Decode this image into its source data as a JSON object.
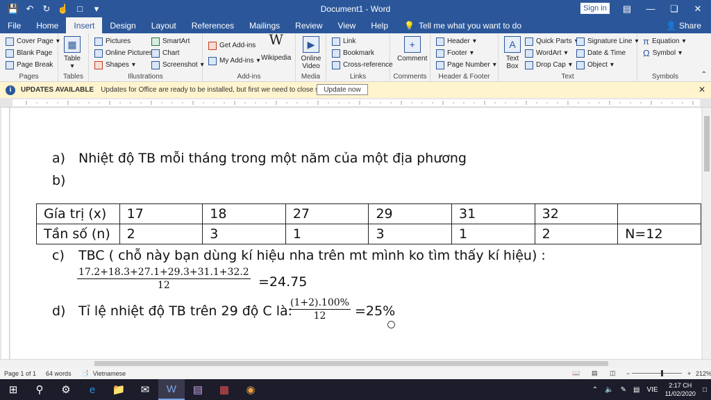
{
  "window": {
    "title": "Document1 - Word",
    "sign_in": "Sign in"
  },
  "tabs": [
    "File",
    "Home",
    "Insert",
    "Design",
    "Layout",
    "References",
    "Mailings",
    "Review",
    "View",
    "Help"
  ],
  "tell_me": "Tell me what you want to do",
  "share": "Share",
  "ribbon": {
    "pages": {
      "label": "Pages",
      "cover": "Cover Page",
      "blank": "Blank Page",
      "break": "Page Break"
    },
    "tables": {
      "label": "Tables",
      "table": "Table"
    },
    "illustrations": {
      "label": "Illustrations",
      "pictures": "Pictures",
      "online_pictures": "Online Pictures",
      "shapes": "Shapes",
      "smartart": "SmartArt",
      "chart": "Chart",
      "screenshot": "Screenshot"
    },
    "addins": {
      "label": "Add-ins",
      "get": "Get Add-ins",
      "my": "My Add-ins",
      "wikipedia": "Wikipedia"
    },
    "media": {
      "label": "Media",
      "online_video": "Online Video"
    },
    "links": {
      "label": "Links",
      "link": "Link",
      "bookmark": "Bookmark",
      "cross": "Cross-reference"
    },
    "comments": {
      "label": "Comments",
      "comment": "Comment"
    },
    "header_footer": {
      "label": "Header & Footer",
      "header": "Header",
      "footer": "Footer",
      "page_number": "Page Number"
    },
    "text": {
      "label": "Text",
      "text_box": "Text Box",
      "quick_parts": "Quick Parts",
      "wordart": "WordArt",
      "drop_cap": "Drop Cap",
      "signature": "Signature Line",
      "datetime": "Date & Time",
      "object": "Object"
    },
    "symbols": {
      "label": "Symbols",
      "equation": "Equation",
      "symbol": "Symbol"
    }
  },
  "infobar": {
    "title": "UPDATES AVAILABLE",
    "message": "Updates for Office are ready to be installed, but first we need to close some apps.",
    "button": "Update now"
  },
  "document": {
    "line_a_marker": "a)",
    "line_a_text": "Nhiệt độ TB mỗi tháng trong một năm của một địa phương",
    "line_b_marker": "b)",
    "table": {
      "row1": [
        "Gía trị (x)",
        "17",
        "18",
        "27",
        "29",
        "31",
        "32",
        ""
      ],
      "row2": [
        "Tần số (n)",
        "2",
        "3",
        "1",
        "3",
        "1",
        "2",
        "N=12"
      ]
    },
    "line_c_marker": "c)",
    "line_c_text": "TBC ( chỗ này bạn dùng kí hiệu nha trên mt mình ko tìm thấy kí hiệu) :",
    "c_numerator": "17.2+18.3+27.1+29.3+31.1+32.2",
    "c_denominator": "12",
    "c_result": "=24.75",
    "line_d_marker": "d)",
    "line_d_text": "Tỉ lệ nhiệt độ TB trên 29 độ C là:",
    "d_numerator": "(1+2).100%",
    "d_denominator": "12",
    "d_result": "=25%"
  },
  "status": {
    "page": "Page 1 of 1",
    "words": "64 words",
    "language": "Vietnamese",
    "zoom": "212%"
  },
  "taskbar": {
    "lang": "VIE",
    "time": "2:17 CH",
    "date": "11/02/2020"
  }
}
